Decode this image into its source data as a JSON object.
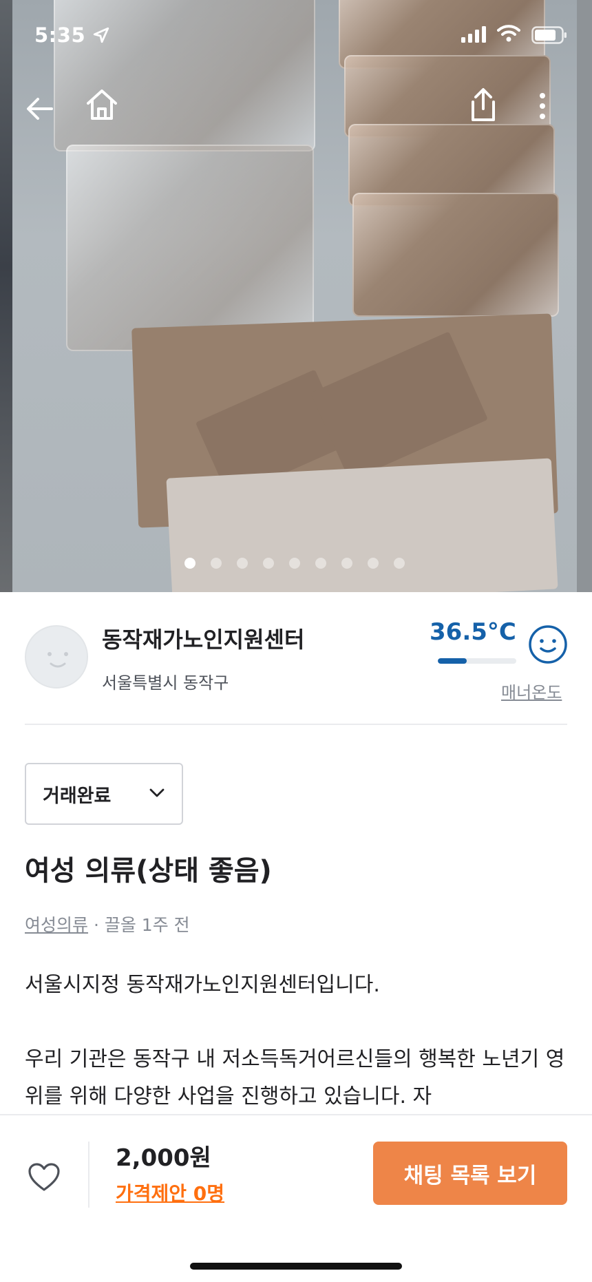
{
  "status_bar": {
    "time": "5:35",
    "icons": [
      "location-arrow-icon",
      "cellular-signal-icon",
      "wifi-icon",
      "battery-icon"
    ]
  },
  "toolbar": {
    "icons": [
      "back-arrow-icon",
      "home-icon",
      "share-icon",
      "more-vertical-icon"
    ]
  },
  "gallery": {
    "photo_count": 9,
    "active_index": 0
  },
  "seller": {
    "name": "동작재가노인지원센터",
    "region": "서울특별시 동작구",
    "temperature": "36.5°C",
    "temperature_value": 36.5,
    "manner_label": "매너온도",
    "accent_color": "#1561a9"
  },
  "listing": {
    "status": "거래완료",
    "title": "여성 의류(상태 좋음)",
    "category": "여성의류",
    "time_meta": " · 끌올 1주 전",
    "description": [
      "서울시지정 동작재가노인지원센터입니다.",
      "우리 기관은 동작구 내 저소득독거어르신들의 행복한 노년기 영위를 위해 다양한 사업을 진행하고 있습니다. 자"
    ]
  },
  "bottom_bar": {
    "price": "2,000원",
    "offer_text": "가격제안 0명",
    "chat_button_label": "채팅 목록 보기",
    "offer_color": "#ff6f0f",
    "button_color": "#ee8548"
  }
}
